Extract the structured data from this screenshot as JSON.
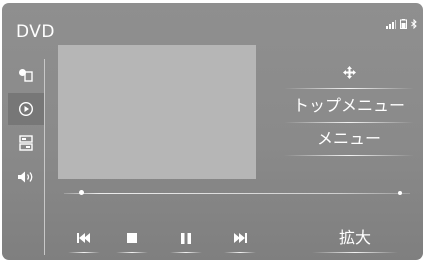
{
  "screen": {
    "title": "DVD"
  },
  "status_bar": {
    "icons": [
      "signal-bars-icon",
      "phone-battery-icon",
      "bluetooth-icon"
    ]
  },
  "sidebar": {
    "items": [
      {
        "icon": "media-source-icon",
        "active": false
      },
      {
        "icon": "play-circle-icon",
        "active": true
      },
      {
        "icon": "disc-settings-icon",
        "active": false
      },
      {
        "icon": "speaker-volume-icon",
        "active": false
      }
    ]
  },
  "menu": {
    "move_icon": "move-cross-icon",
    "top_menu_label": "トップメニュー",
    "menu_label": "メニュー"
  },
  "playback": {
    "position_fraction": 0.05,
    "controls": [
      "skip-back-icon",
      "stop-icon",
      "pause-icon",
      "skip-forward-icon"
    ],
    "zoom_label": "拡大"
  },
  "colors": {
    "background": "#8c8c8c",
    "video_area": "#b6b6b6",
    "text": "#ffffff",
    "active_tab": "#777777"
  }
}
